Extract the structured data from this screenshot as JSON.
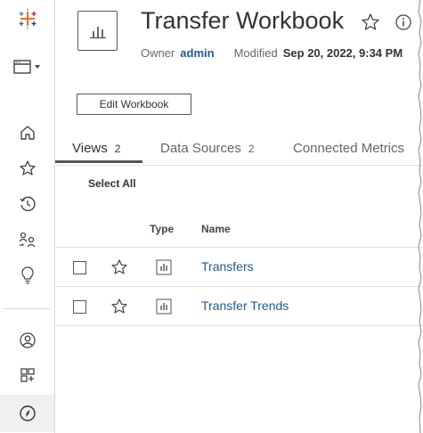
{
  "sidebar": {
    "items": [
      {
        "name": "tableau-logo-icon"
      },
      {
        "name": "app-switcher-icon"
      },
      {
        "name": "home-icon"
      },
      {
        "name": "favorites-icon"
      },
      {
        "name": "recents-icon"
      },
      {
        "name": "shared-with-me-icon"
      },
      {
        "name": "recommendations-icon"
      },
      {
        "name": "personal-space-icon"
      },
      {
        "name": "collections-icon"
      },
      {
        "name": "explore-icon"
      }
    ]
  },
  "workbook": {
    "title": "Transfer Workbook",
    "owner_label": "Owner",
    "owner": "admin",
    "modified_label": "Modified",
    "modified": "Sep 20, 2022, 9:34 PM",
    "edit_label": "Edit Workbook"
  },
  "tabs": [
    {
      "label": "Views",
      "count": "2"
    },
    {
      "label": "Data Sources",
      "count": "2"
    },
    {
      "label": "Connected Metrics",
      "count": ""
    }
  ],
  "list": {
    "select_all": "Select All",
    "columns": {
      "type": "Type",
      "name": "Name"
    },
    "rows": [
      {
        "name": "Transfers"
      },
      {
        "name": "Transfer Trends"
      }
    ]
  },
  "colors": {
    "link": "#1f5a96",
    "text": "#333333",
    "border": "#d9d9d9"
  }
}
